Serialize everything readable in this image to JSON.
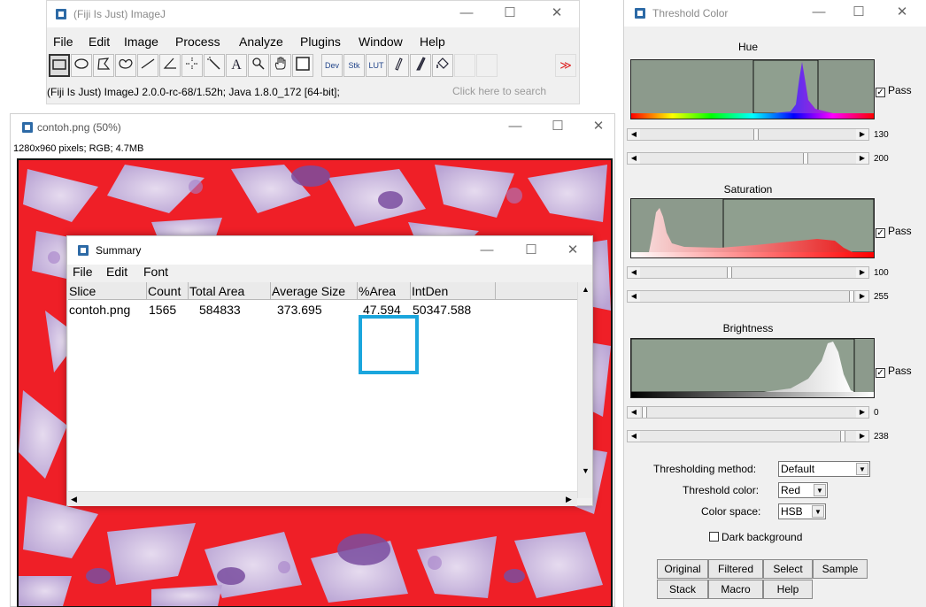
{
  "imagej": {
    "title": "(Fiji Is Just) ImageJ",
    "menu": [
      "File",
      "Edit",
      "Image",
      "Process",
      "Analyze",
      "Plugins",
      "Window",
      "Help"
    ],
    "tools": [
      "rectangle-tool",
      "oval-tool",
      "polygon-tool",
      "freehand-tool",
      "line-tool",
      "angle-tool",
      "point-tool",
      "wand-tool",
      "text-tool",
      "magnifier-tool",
      "hand-tool",
      "color-picker-tool",
      "dev-tool",
      "stk-tool",
      "lut-tool",
      "pencil-tool",
      "brush-tool",
      "flood-fill-tool",
      "more-tools"
    ],
    "tool_labels": {
      "text": "A",
      "dev": "Dev",
      "stk": "Stk",
      "lut": "LUT",
      "more": "≫"
    },
    "status": "(Fiji Is Just) ImageJ 2.0.0-rc-68/1.52h; Java 1.8.0_172 [64-bit];",
    "search_hint": "Click here to search"
  },
  "image_window": {
    "title": "contoh.png (50%)",
    "info": "1280x960 pixels; RGB; 4.7MB"
  },
  "summary": {
    "title": "Summary",
    "menu": [
      "File",
      "Edit",
      "Font"
    ],
    "columns": [
      "Slice",
      "Count",
      "Total Area",
      "Average Size",
      "%Area",
      "IntDen"
    ],
    "rows": [
      [
        "contoh.png",
        "1565",
        "584833",
        "373.695",
        "47.594",
        "50347.588"
      ]
    ],
    "highlight_color": "#1ba6dd"
  },
  "threshold": {
    "title": "Threshold Color",
    "hue": {
      "label": "Hue",
      "min": "130",
      "max": "200",
      "pass": "Pass"
    },
    "saturation": {
      "label": "Saturation",
      "min": "100",
      "max": "255",
      "pass": "Pass"
    },
    "brightness": {
      "label": "Brightness",
      "min": "0",
      "max": "238",
      "pass": "Pass"
    },
    "method_label": "Thresholding method:",
    "method_value": "Default",
    "color_label": "Threshold color:",
    "color_value": "Red",
    "space_label": "Color space:",
    "space_value": "HSB",
    "dark_bg_label": "Dark background",
    "buttons_row1": [
      "Original",
      "Filtered",
      "Select",
      "Sample"
    ],
    "buttons_row2": [
      "Stack",
      "Macro",
      "Help"
    ]
  },
  "window_controls": {
    "minimize": "—",
    "maximize": "☐",
    "close": "✕"
  },
  "colors": {
    "overlay_red": "#ef1f27",
    "tissue_lavender": "#c9b8e0",
    "purple": "#7a4ea0",
    "plot_gray": "#8c9a8c"
  }
}
